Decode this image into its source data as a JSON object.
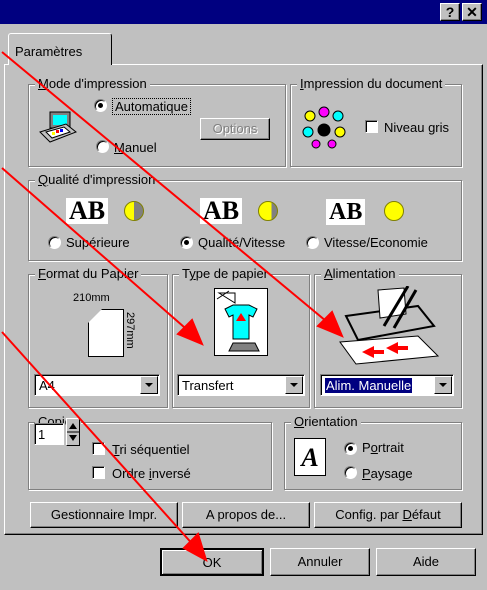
{
  "titlebar": {
    "help": "?",
    "close": "✕"
  },
  "tab": {
    "label": "Paramètres"
  },
  "mode": {
    "legend_first": "M",
    "legend_rest": "ode d'impression",
    "automatique": "Automatique",
    "manuel_first": "M",
    "manuel_rest": "anuel",
    "options": "Options"
  },
  "document": {
    "legend_first": "I",
    "legend_rest": "mpression du document",
    "niveau_gris": "Niveau gris"
  },
  "qualite": {
    "legend_first": "Q",
    "legend_rest": "ualité d'impression",
    "ab": "AB",
    "superieure": "Supérieure",
    "qualite_vitesse": "Qualité/Vitesse",
    "vitesse_economie": "Vitesse/Economie"
  },
  "format": {
    "legend_first": "F",
    "legend_rest": "ormat du Papier",
    "width": "210mm",
    "height": "297mm",
    "value": "A4"
  },
  "type": {
    "legend_pre": "T",
    "legend_u": "y",
    "legend_rest": "pe de papier",
    "value": "Transfert"
  },
  "alimentation": {
    "legend_first": "A",
    "legend_rest": "limentation",
    "value": "Alim. Manuelle"
  },
  "copies": {
    "legend_first": "C",
    "legend_rest": "opies",
    "count": "1",
    "tri_first": "T",
    "tri_rest": "ri séquentiel",
    "ordre_pre": "O",
    "ordre_mid": "rdre ",
    "ordre_u": "i",
    "ordre_rest": "nversé"
  },
  "orientation": {
    "legend_first": "O",
    "legend_rest": "rientation",
    "portrait_pre": "P",
    "portrait_u": "o",
    "portrait_rest": "rtrait",
    "paysage_first": "P",
    "paysage_rest": "aysage",
    "icon_letter": "A"
  },
  "panel_buttons": {
    "gestionnaire": "Gestionnaire Impr.",
    "apropos": "A propos de...",
    "config_pre": "Config. par ",
    "config_u": "D",
    "config_rest": "éfaut"
  },
  "dialog_buttons": {
    "ok": "OK",
    "annuler": "Annuler",
    "aide": "Aide"
  },
  "colors": {
    "title_bg": "#000080",
    "face": "#c0c0c0",
    "arrow": "#ff0000"
  }
}
